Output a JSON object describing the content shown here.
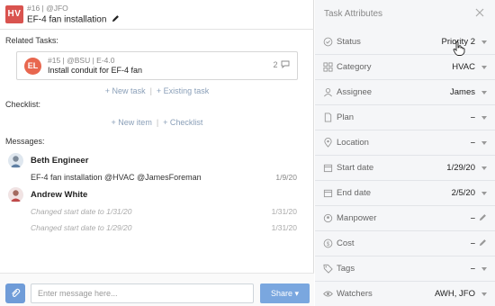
{
  "task": {
    "badge": "HV",
    "meta": "#16 | @JFO",
    "title": "EF-4 fan installation"
  },
  "related": {
    "section_label": "Related Tasks:",
    "card": {
      "badge": "EL",
      "meta": "#15 | @BSU | E-4.0",
      "title": "Install conduit for EF-4 fan",
      "comment_count": "2"
    },
    "new_task_label": "+ New task",
    "existing_task_label": "+ Existing task"
  },
  "checklist": {
    "section_label": "Checklist:",
    "new_item_label": "+ New item",
    "add_checklist_label": "+ Checklist"
  },
  "messages": {
    "section_label": "Messages:",
    "items": [
      {
        "author": "Beth Engineer",
        "text": "EF-4 fan installation @HVAC @JamesForeman",
        "date": "1/9/20"
      },
      {
        "author": "Andrew White",
        "system": [
          {
            "text": "Changed start date to 1/31/20",
            "date": "1/31/20"
          },
          {
            "text": "Changed start date to 1/29/20",
            "date": "1/31/20"
          }
        ]
      }
    ]
  },
  "composer": {
    "placeholder": "Enter message here...",
    "share_label": "Share ▾"
  },
  "attributes": {
    "header": "Task Attributes",
    "rows": [
      {
        "label": "Status",
        "value": "Priority 2",
        "control": "dropdown",
        "icon": "status-icon"
      },
      {
        "label": "Category",
        "value": "HVAC",
        "control": "dropdown",
        "icon": "category-icon"
      },
      {
        "label": "Assignee",
        "value": "James",
        "control": "dropdown",
        "icon": "user-icon"
      },
      {
        "label": "Plan",
        "value": "–",
        "control": "dropdown",
        "icon": "document-icon"
      },
      {
        "label": "Location",
        "value": "–",
        "control": "dropdown",
        "icon": "location-pin-icon"
      },
      {
        "label": "Start date",
        "value": "1/29/20",
        "control": "dropdown",
        "icon": "calendar-icon"
      },
      {
        "label": "End date",
        "value": "2/5/20",
        "control": "dropdown",
        "icon": "calendar-icon"
      },
      {
        "label": "Manpower",
        "value": "–",
        "control": "edit",
        "icon": "manpower-icon"
      },
      {
        "label": "Cost",
        "value": "–",
        "control": "edit",
        "icon": "dollar-icon"
      },
      {
        "label": "Tags",
        "value": "–",
        "control": "dropdown",
        "icon": "tag-icon"
      },
      {
        "label": "Watchers",
        "value": "AWH, JFO",
        "control": "dropdown",
        "icon": "eye-icon"
      }
    ]
  },
  "colors": {
    "hv_badge": "#d9534f",
    "el_badge": "#e8674f",
    "link": "#8a9fb8",
    "share_button": "#7aa7df",
    "attach_button": "#6f9cd8",
    "right_panel_bg": "#f5f6f8"
  }
}
